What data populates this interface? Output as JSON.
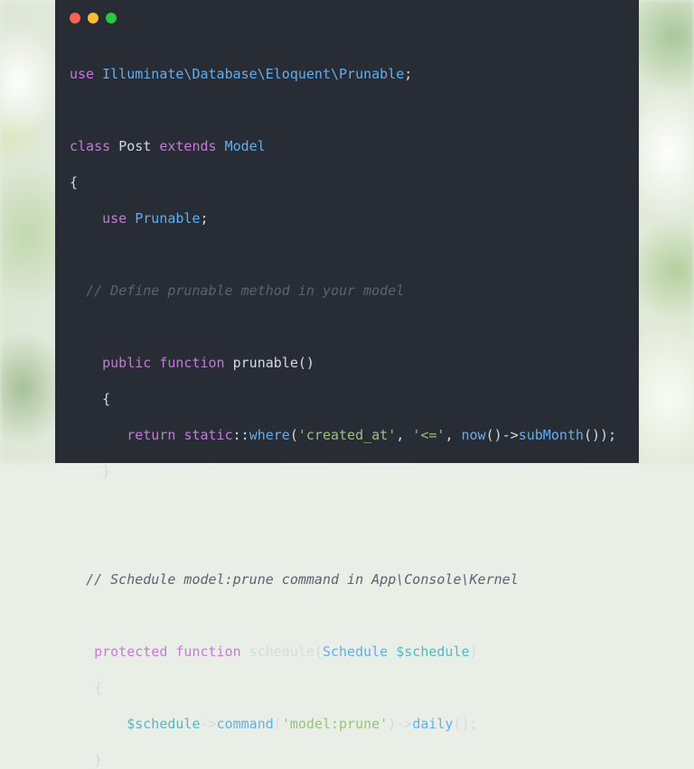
{
  "window": {
    "controls": [
      {
        "name": "close",
        "color": "#ff5f57"
      },
      {
        "name": "minimize",
        "color": "#febc2e"
      },
      {
        "name": "maximize",
        "color": "#28c840"
      }
    ]
  },
  "code": {
    "line1": [
      "use",
      "Illuminate\\Database\\Eloquent\\Prunable",
      ";"
    ],
    "line3": [
      "class",
      "Post",
      "extends",
      "Model"
    ],
    "line4": [
      "{"
    ],
    "line5": [
      "use",
      "Prunable",
      ";"
    ],
    "line7": [
      "// Define prunable method in your model"
    ],
    "line9": [
      "public",
      "function",
      "prunable",
      "()"
    ],
    "line10": [
      "{"
    ],
    "line11": [
      "return",
      "static",
      "::",
      "where",
      "(",
      "'created_at'",
      ", ",
      "'<='",
      ", ",
      "now",
      "()->",
      "subMonth",
      "());"
    ],
    "line12": [
      "}"
    ],
    "line15": [
      "// Schedule model:prune command in App\\Console\\Kernel"
    ],
    "line17": [
      "protected",
      "function",
      "schedule",
      "(",
      "Schedule",
      "$schedule",
      ")"
    ],
    "line18": [
      "{"
    ],
    "line19": [
      "$schedule",
      "->",
      "command",
      "(",
      "'model:prune'",
      ")->",
      "daily",
      "();"
    ],
    "line20": [
      "}"
    ]
  }
}
